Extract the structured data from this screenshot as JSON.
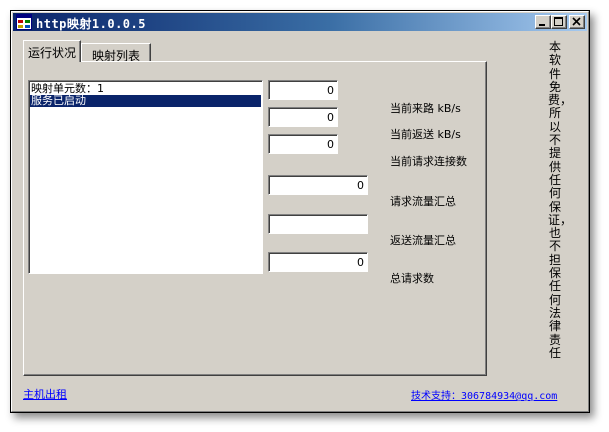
{
  "window": {
    "title": "http映射1.0.0.5"
  },
  "tabs": [
    {
      "label": "运行状况",
      "active": true
    },
    {
      "label": "映射列表",
      "active": false
    }
  ],
  "listbox": {
    "items": [
      {
        "text": "映射单元数：1",
        "selected": false
      },
      {
        "text": "服务已启动",
        "selected": true
      }
    ]
  },
  "stats": {
    "incoming_rate": {
      "value": "0",
      "label": "当前来路 kB/s"
    },
    "outgoing_rate": {
      "value": "0",
      "label": "当前返送 kB/s"
    },
    "connections": {
      "value": "0",
      "label": "当前请求连接数"
    },
    "request_total": {
      "value": "0",
      "label": "请求流量汇总"
    },
    "response_total": {
      "value": "",
      "label": "返送流量汇总"
    },
    "request_count": {
      "value": "0",
      "label": "总请求数"
    }
  },
  "side_note": "本软件免费，所以不提供任何保证，也不担保任何法律责任",
  "footer": {
    "host_link": "主机出租",
    "support_link": "技术支持：306784934@qq.com"
  },
  "colors": {
    "face": "#d4d0c8",
    "title_start": "#0a246a",
    "title_end": "#a6caf0",
    "selection": "#0a246a",
    "link": "#0000ff"
  },
  "icons": {
    "app": "app-window-icon",
    "minimize": "minimize-icon",
    "maximize": "maximize-icon",
    "close": "close-icon"
  }
}
